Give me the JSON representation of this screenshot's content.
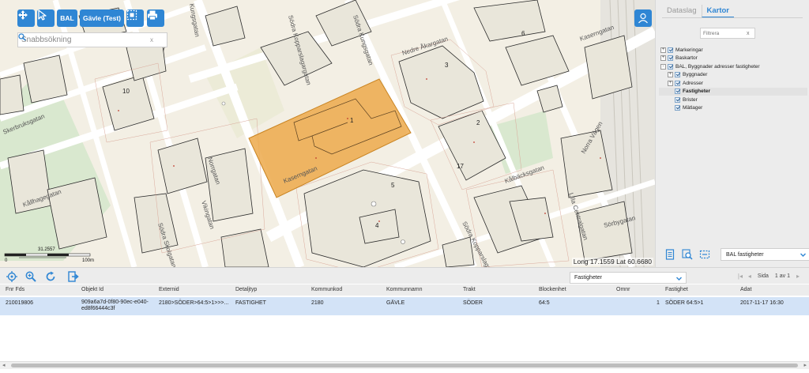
{
  "toolbar": {
    "bal_label": "BAL",
    "municipality_label": "Gävle (Test)",
    "search_placeholder": "Snabbsökning",
    "search_clear": "x"
  },
  "map": {
    "street_labels": [
      "Kaserngatan",
      "Kaserngatan",
      "Nedre Åkargatan",
      "Kållhagegatan",
      "Skerbruksgatan",
      "Kålbäcksgatan",
      "Södra Kopparslagargatan",
      "Södra Skolgatan",
      "Vikingatan",
      "Lilla Centralgatan",
      "Sörbygatan",
      "Norrgatan",
      "Kungsgatan",
      "Södra Kopparslagargatan",
      "Södra Kungsgatan",
      "Norra Vägen"
    ],
    "block_numbers": [
      "1",
      "2",
      "3",
      "4",
      "5",
      "6",
      "17",
      "10",
      "7"
    ],
    "scale_labels": [
      "0",
      "31.2557",
      "100m"
    ],
    "coordinates": "Long 17.1559 Lat 60.6680",
    "highlight_color": "#eca94b"
  },
  "side_panel": {
    "tabs": [
      "Dataslag",
      "Kartor"
    ],
    "active_tab": "Kartor",
    "filter_placeholder": "Filtrera",
    "filter_clear": "x",
    "layers": [
      {
        "label": "Markeringar",
        "depth": 0,
        "expander": "+",
        "checked": true
      },
      {
        "label": "Baskartor",
        "depth": 0,
        "expander": "+",
        "checked": true
      },
      {
        "label": "BAL, Byggnader adresser fastigheter",
        "depth": 0,
        "expander": "-",
        "checked": true
      },
      {
        "label": "Byggnader",
        "depth": 1,
        "expander": "+",
        "checked": true
      },
      {
        "label": "Adresser",
        "depth": 1,
        "expander": "+",
        "checked": true
      },
      {
        "label": "Fastigheter",
        "depth": 1,
        "expander": "",
        "checked": true,
        "selected": true
      },
      {
        "label": "Brister",
        "depth": 1,
        "expander": "",
        "checked": true
      },
      {
        "label": "Mätlager",
        "depth": 1,
        "expander": "",
        "checked": true
      }
    ],
    "layer_select_value": "BAL fastigheter"
  },
  "results": {
    "type_select_value": "Fastigheter",
    "pager": {
      "label": "Sida",
      "page_text": "1 av 1"
    },
    "columns": [
      "Fnr Fds",
      "Objekt Id",
      "Externid",
      "Detaljtyp",
      "Kommunkod",
      "Kommunnamn",
      "Trakt",
      "Blockenhet",
      "Omnr",
      "Fastighet",
      "Adat"
    ],
    "rows": [
      [
        "210019806",
        "909a6a7d-0f80-90ec-e040-\ned8f66444c3f",
        "2180>SÖDER>64:5>1>>>...",
        "FASTIGHET",
        "2180",
        "GÄVLE",
        "SÖDER",
        "64:5",
        "1",
        "SÖDER 64:5>1",
        "2017-11-17 16:30"
      ]
    ]
  },
  "colors": {
    "accent": "#2f86d4",
    "row_highlight": "#d3e3f7"
  }
}
